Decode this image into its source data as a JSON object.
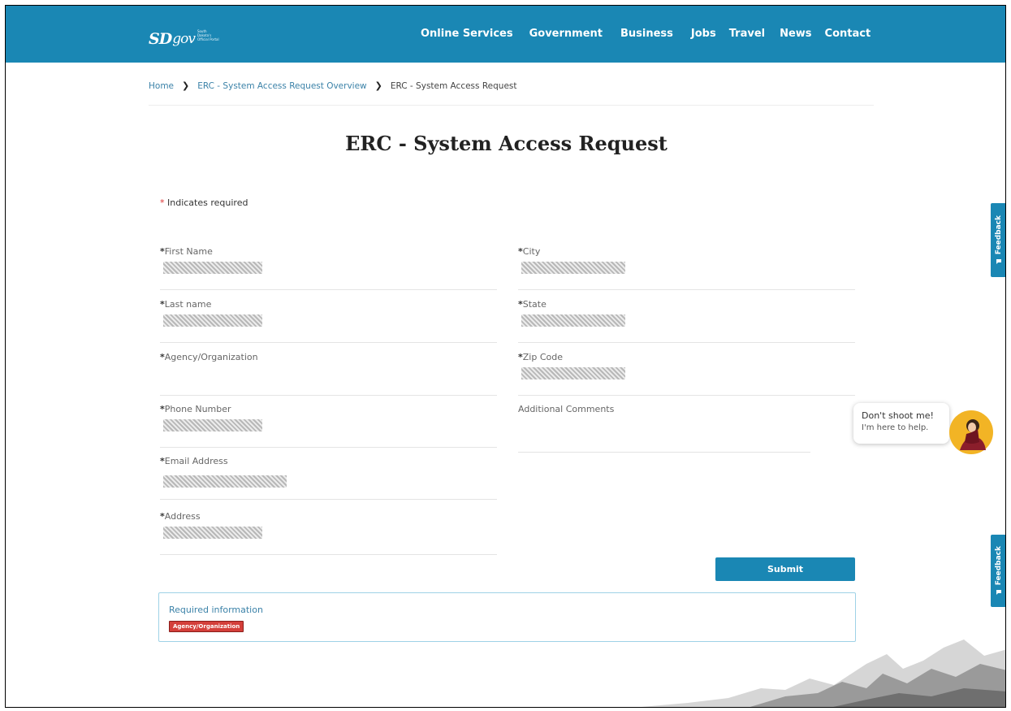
{
  "header": {
    "logo_main": "SD",
    "logo_gov": "gov",
    "logo_tagline": "South Dakota's Official Portal",
    "nav": [
      "Online Services",
      "Government",
      "Business",
      "Jobs",
      "Travel",
      "News",
      "Contact"
    ]
  },
  "breadcrumb": [
    "Home",
    "ERC - System Access Request Overview",
    "ERC - System Access Request"
  ],
  "page_title": "ERC - System Access Request",
  "required_note": "Indicates required",
  "required_star": "*",
  "form": {
    "first_name": {
      "label": "First Name",
      "required": true
    },
    "last_name": {
      "label": "Last name",
      "required": true
    },
    "agency": {
      "label": "Agency/Organization",
      "required": true
    },
    "phone": {
      "label": "Phone Number",
      "required": true
    },
    "email": {
      "label": "Email Address",
      "required": true
    },
    "address": {
      "label": "Address",
      "required": true
    },
    "city": {
      "label": "City",
      "required": true
    },
    "state": {
      "label": "State",
      "required": true
    },
    "zip": {
      "label": "Zip Code",
      "required": true
    },
    "comments": {
      "label": "Additional Comments",
      "required": false
    }
  },
  "submit_label": "Submit",
  "required_info": {
    "heading": "Required information",
    "missing": [
      "Agency/Organization"
    ]
  },
  "feedback_label": "Feedback",
  "chat": {
    "line1": "Don't shoot me!",
    "line2": "I'm here to help."
  },
  "colors": {
    "brand": "#1a87b4",
    "error": "#d43f3a",
    "link": "#3b82a8"
  }
}
